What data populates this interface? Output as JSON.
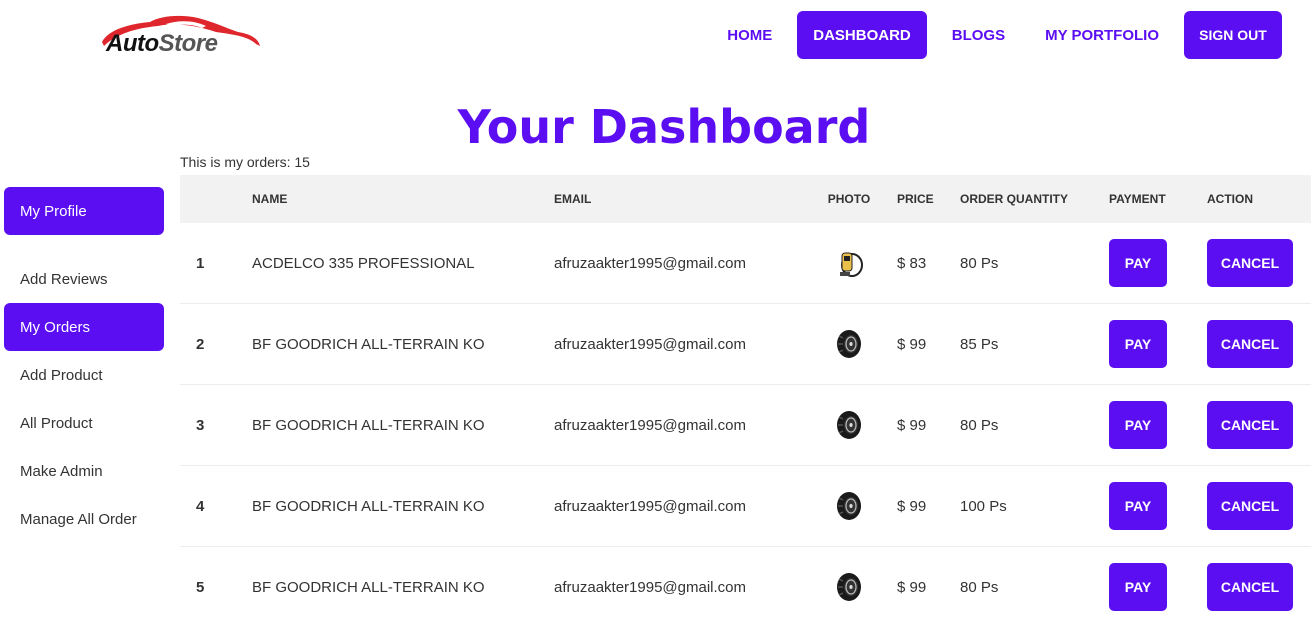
{
  "brand": {
    "part1": "Auto",
    "part2": "Store"
  },
  "nav": {
    "items": [
      "HOME",
      "DASHBOARD",
      "BLOGS",
      "MY PORTFOLIO"
    ],
    "active": "DASHBOARD",
    "signout": "SIGN OUT"
  },
  "page": {
    "title": "Your Dashboard",
    "orders_label": "This is my orders: 15"
  },
  "sidebar": {
    "items": [
      {
        "label": "My Profile",
        "active": true
      },
      {
        "label": "Add Reviews",
        "active": false
      },
      {
        "label": "My Orders",
        "active": true
      },
      {
        "label": "Add Product",
        "active": false
      },
      {
        "label": "All Product",
        "active": false
      },
      {
        "label": "Make Admin",
        "active": false
      },
      {
        "label": "Manage All Order",
        "active": false
      }
    ]
  },
  "table": {
    "headers": [
      "",
      "NAME",
      "EMAIL",
      "PHOTO",
      "PRICE",
      "ORDER QUANTITY",
      "PAYMENT",
      "ACTION"
    ],
    "rows": [
      {
        "num": "1",
        "name": "ACDELCO 335 PROFESSIONAL",
        "email": "afruzaakter1995@gmail.com",
        "photo": "tool-image",
        "price": "$ 83",
        "qty": "80 Ps",
        "pay": "PAY",
        "action": "CANCEL"
      },
      {
        "num": "2",
        "name": "BF GOODRICH ALL-TERRAIN KO",
        "email": "afruzaakter1995@gmail.com",
        "photo": "tire-image",
        "price": "$ 99",
        "qty": "85 Ps",
        "pay": "PAY",
        "action": "CANCEL"
      },
      {
        "num": "3",
        "name": "BF GOODRICH ALL-TERRAIN KO",
        "email": "afruzaakter1995@gmail.com",
        "photo": "tire-image",
        "price": "$ 99",
        "qty": "80 Ps",
        "pay": "PAY",
        "action": "CANCEL"
      },
      {
        "num": "4",
        "name": "BF GOODRICH ALL-TERRAIN KO",
        "email": "afruzaakter1995@gmail.com",
        "photo": "tire-image",
        "price": "$ 99",
        "qty": "100 Ps",
        "pay": "PAY",
        "action": "CANCEL"
      },
      {
        "num": "5",
        "name": "BF GOODRICH ALL-TERRAIN KO",
        "email": "afruzaakter1995@gmail.com",
        "photo": "tire-image",
        "price": "$ 99",
        "qty": "80 Ps",
        "pay": "PAY",
        "action": "CANCEL"
      }
    ]
  },
  "colors": {
    "accent": "#5b0ef2",
    "logo_red": "#e0262d",
    "header_bg": "#f2f2f2"
  }
}
